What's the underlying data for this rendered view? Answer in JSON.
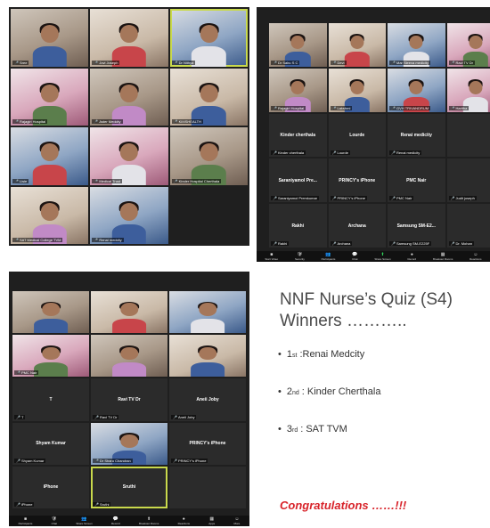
{
  "shot1": {
    "tiles": [
      {
        "name": "Sree",
        "type": "video"
      },
      {
        "name": "Jovi Joseph",
        "type": "video"
      },
      {
        "name": "Dr Nithya",
        "type": "video",
        "active": true
      },
      {
        "name": "Rajagiri Hospital",
        "type": "video"
      },
      {
        "name": "Aster Medcity",
        "type": "video"
      },
      {
        "name": "KIMSHEALTH",
        "type": "video"
      },
      {
        "name": "Lisie",
        "type": "video"
      },
      {
        "name": "Medical Trust",
        "type": "video"
      },
      {
        "name": "Kinder Hospital Cherthala",
        "type": "video"
      },
      {
        "name": "SAT Medical College TVM",
        "type": "video"
      },
      {
        "name": "Renai medcity",
        "type": "video"
      }
    ]
  },
  "shot2": {
    "tiles": [
      {
        "name": "Dr Sabu S C",
        "type": "video"
      },
      {
        "name": "Devi",
        "type": "video"
      },
      {
        "name": "Mar Sleeva medicity",
        "type": "video"
      },
      {
        "name": "Ravi TV Dr",
        "type": "video"
      },
      {
        "name": "Rajagiri Hospital",
        "type": "video"
      },
      {
        "name": "Lakshmi",
        "type": "video"
      },
      {
        "name": "GVH TRIVANDRUM",
        "type": "video"
      },
      {
        "name": "Haritha",
        "type": "video"
      },
      {
        "label": "Kinder cherthala",
        "name": "Kinder cherthala"
      },
      {
        "label": "Lourde",
        "name": "Lourde"
      },
      {
        "label": "Renai medicity",
        "name": "Renai medicity"
      },
      {
        "label": "",
        "name": ""
      },
      {
        "label": "Saraniyamol Pre...",
        "name": "Saraniyamol Premkumar"
      },
      {
        "label": "PRINCY's iPhone",
        "name": "PRINCY's iPhone"
      },
      {
        "label": "PMC Nair",
        "name": "PMC Nair"
      },
      {
        "label": "",
        "name": "Judit joseph"
      },
      {
        "label": "Rakhi",
        "name": "Rakhi"
      },
      {
        "label": "Archana",
        "name": "Archana"
      },
      {
        "label": "Samsung SM-E2...",
        "name": "Samsung SM-E225F"
      },
      {
        "label": "",
        "name": "Dr. Mohan"
      }
    ],
    "toolbar": [
      "Start Video",
      "Security",
      "Participants",
      "Chat",
      "Share Screen",
      "Record",
      "Breakout Rooms",
      "Reactions"
    ]
  },
  "shot3": {
    "tiles": [
      {
        "name": "",
        "type": "video"
      },
      {
        "name": "",
        "type": "video"
      },
      {
        "name": "",
        "type": "video"
      },
      {
        "name": "PMC Nair",
        "type": "video"
      },
      {
        "name": "",
        "type": "video"
      },
      {
        "name": "",
        "type": "video"
      },
      {
        "label": "T",
        "name": "T"
      },
      {
        "label": "Ravi TV Dr",
        "name": "Ravi TV Dr"
      },
      {
        "label": "Aneii Joby",
        "name": "Aneii Joby"
      },
      {
        "label": "Shyam Kumar",
        "name": "Shyam Kumar"
      },
      {
        "label": "",
        "name": "Dr Sharu Chandran",
        "type": "video"
      },
      {
        "label": "PRINCY's iPhone",
        "name": "PRINCY's iPhone"
      },
      {
        "label": "iPhone",
        "name": "iPhone"
      },
      {
        "label": "Sruthi",
        "name": "Sruthi",
        "active": true
      },
      {
        "label": "",
        "name": ""
      }
    ],
    "toolbar": [
      "Participants",
      "Chat",
      "Share Screen",
      "Record",
      "Breakout Rooms",
      "Reactions",
      "Apps",
      "More"
    ]
  },
  "title_line1": "NNF Nurse’s Quiz (S4)",
  "title_line2": "Winners ………..",
  "winners": [
    {
      "rank": "1",
      "suffix": "st",
      "name": ":Renai Medcity"
    },
    {
      "rank": "2",
      "suffix": "nd",
      "name": ": Kinder Cherthala"
    },
    {
      "rank": "3",
      "suffix": "rd",
      "name": ":  SAT TVM"
    }
  ],
  "congrats": "Congratulations ……!!!"
}
